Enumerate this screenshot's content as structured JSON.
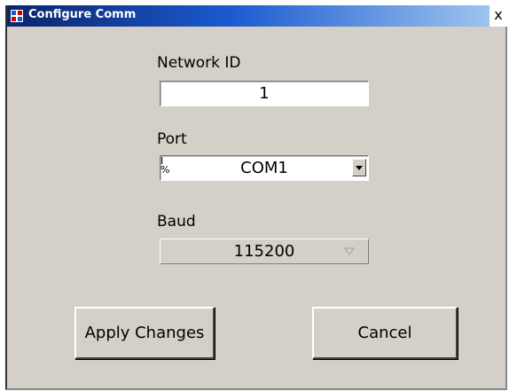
{
  "window": {
    "title": "Configure Comm",
    "close_label": "x",
    "icon": "app-icon"
  },
  "network": {
    "label": "Network ID",
    "value": "1"
  },
  "port": {
    "label": "Port",
    "value": "COM1",
    "glyph": "I/O",
    "arrow_icon": "chevron-down-icon"
  },
  "baud": {
    "label": "Baud",
    "value": "115200",
    "arrow_icon": "chevron-down-icon"
  },
  "buttons": {
    "apply": "Apply Changes",
    "cancel": "Cancel"
  }
}
